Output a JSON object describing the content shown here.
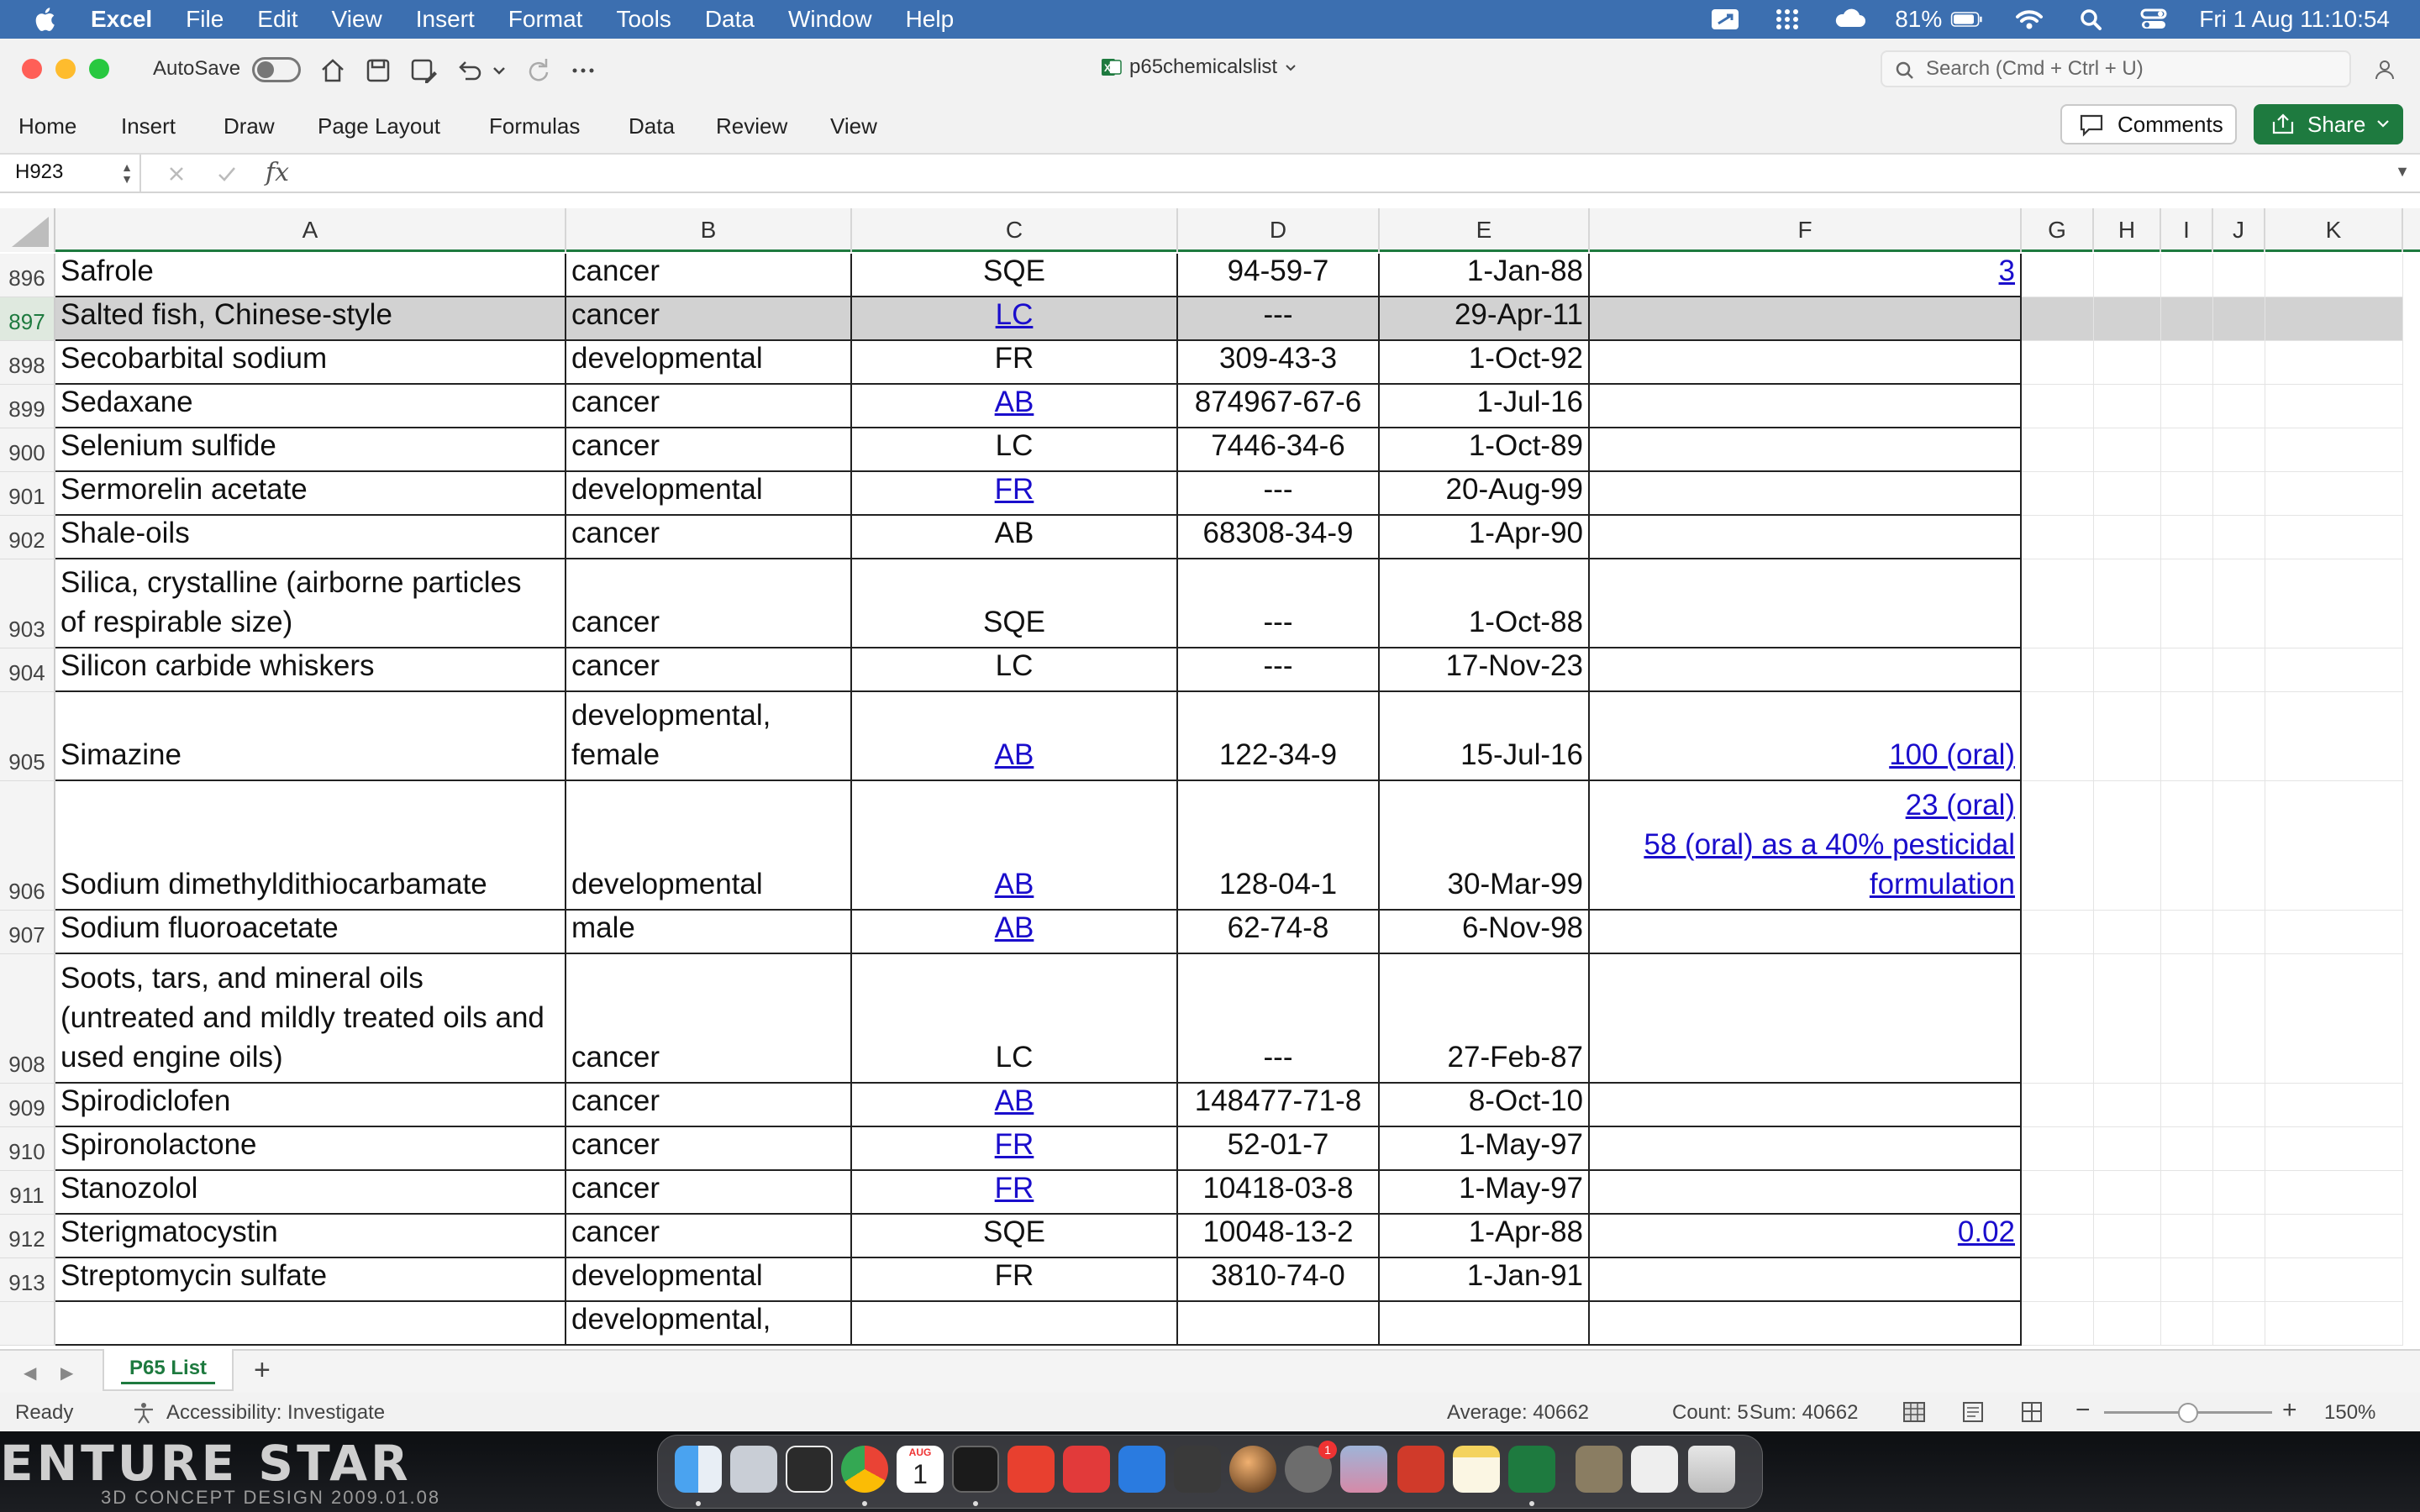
{
  "menubar": {
    "app": "Excel",
    "items": [
      "File",
      "Edit",
      "View",
      "Insert",
      "Format",
      "Tools",
      "Data",
      "Window",
      "Help"
    ],
    "battery": "81%",
    "datetime": "Fri 1 Aug  11:10:54"
  },
  "titlebar": {
    "autosave_label": "AutoSave",
    "doc_title": "p65chemicalslist",
    "search_placeholder": "Search (Cmd + Ctrl + U)"
  },
  "ribbon": {
    "tabs": [
      "Home",
      "Insert",
      "Draw",
      "Page Layout",
      "Formulas",
      "Data",
      "Review",
      "View"
    ],
    "comments": "Comments",
    "share": "Share"
  },
  "formula_bar": {
    "name_box": "H923",
    "fx": "fx",
    "value": ""
  },
  "columns": [
    "A",
    "B",
    "C",
    "D",
    "E",
    "F",
    "G",
    "H",
    "I",
    "J",
    "K"
  ],
  "rows": [
    {
      "n": "896",
      "a": [
        "Safrole"
      ],
      "b": [
        "cancer"
      ],
      "c": "SQE",
      "c_link": false,
      "d": "94-59-7",
      "e": "1-Jan-88",
      "f": [
        "3"
      ],
      "f_link": true
    },
    {
      "n": "897",
      "a": [
        "Salted fish, Chinese-style"
      ],
      "b": [
        "cancer"
      ],
      "c": "LC",
      "c_link": true,
      "d": "---",
      "e": "29-Apr-11",
      "f": [],
      "f_link": false,
      "selected": true
    },
    {
      "n": "898",
      "a": [
        "Secobarbital sodium"
      ],
      "b": [
        "developmental"
      ],
      "c": "FR",
      "c_link": false,
      "d": "309-43-3",
      "e": "1-Oct-92",
      "f": [],
      "f_link": false
    },
    {
      "n": "899",
      "a": [
        "Sedaxane"
      ],
      "b": [
        "cancer"
      ],
      "c": "AB",
      "c_link": true,
      "d": "874967-67-6",
      "e": "1-Jul-16",
      "f": [],
      "f_link": false
    },
    {
      "n": "900",
      "a": [
        "Selenium sulfide"
      ],
      "b": [
        "cancer"
      ],
      "c": "LC",
      "c_link": false,
      "d": "7446-34-6",
      "e": "1-Oct-89",
      "f": [],
      "f_link": false
    },
    {
      "n": "901",
      "a": [
        "Sermorelin acetate"
      ],
      "b": [
        "developmental"
      ],
      "c": "FR",
      "c_link": true,
      "d": "---",
      "e": "20-Aug-99",
      "f": [],
      "f_link": false
    },
    {
      "n": "902",
      "a": [
        "Shale-oils"
      ],
      "b": [
        "cancer"
      ],
      "c": "AB",
      "c_link": false,
      "d": "68308-34-9",
      "e": "1-Apr-90",
      "f": [],
      "f_link": false
    },
    {
      "n": "903",
      "a": [
        "Silica, crystalline (airborne particles",
        "of respirable size)"
      ],
      "b": [
        "cancer"
      ],
      "c": "SQE",
      "c_link": false,
      "d": "---",
      "e": "1-Oct-88",
      "f": [],
      "f_link": false
    },
    {
      "n": "904",
      "a": [
        "Silicon carbide whiskers"
      ],
      "b": [
        "cancer"
      ],
      "c": "LC",
      "c_link": false,
      "d": "---",
      "e": "17-Nov-23",
      "f": [],
      "f_link": false
    },
    {
      "n": "905",
      "a": [
        "Simazine"
      ],
      "b": [
        "developmental,",
        "female"
      ],
      "c": "AB",
      "c_link": true,
      "d": "122-34-9",
      "e": "15-Jul-16",
      "f": [
        "100 (oral)"
      ],
      "f_link": true
    },
    {
      "n": "906",
      "a": [
        "Sodium dimethyldithiocarbamate"
      ],
      "b": [
        "developmental"
      ],
      "c": "AB",
      "c_link": true,
      "d": "128-04-1",
      "e": "30-Mar-99",
      "f": [
        "23 (oral)",
        "58 (oral) as a 40% pesticidal",
        "formulation"
      ],
      "f_link": true
    },
    {
      "n": "907",
      "a": [
        "Sodium fluoroacetate"
      ],
      "b": [
        "male"
      ],
      "c": "AB",
      "c_link": true,
      "d": "62-74-8",
      "e": "6-Nov-98",
      "f": [],
      "f_link": false
    },
    {
      "n": "908",
      "a": [
        "Soots, tars, and mineral oils",
        "(untreated and mildly treated oils and",
        "used engine oils)"
      ],
      "b": [
        "cancer"
      ],
      "c": "LC",
      "c_link": false,
      "d": "---",
      "e": "27-Feb-87",
      "f": [],
      "f_link": false
    },
    {
      "n": "909",
      "a": [
        "Spirodiclofen"
      ],
      "b": [
        "cancer"
      ],
      "c": "AB",
      "c_link": true,
      "d": "148477-71-8",
      "e": "8-Oct-10",
      "f": [],
      "f_link": false
    },
    {
      "n": "910",
      "a": [
        "Spironolactone"
      ],
      "b": [
        "cancer"
      ],
      "c": "FR",
      "c_link": true,
      "d": "52-01-7",
      "e": "1-May-97",
      "f": [],
      "f_link": false
    },
    {
      "n": "911",
      "a": [
        "Stanozolol"
      ],
      "b": [
        "cancer"
      ],
      "c": "FR",
      "c_link": true,
      "d": "10418-03-8",
      "e": "1-May-97",
      "f": [],
      "f_link": false
    },
    {
      "n": "912",
      "a": [
        "Sterigmatocystin"
      ],
      "b": [
        "cancer"
      ],
      "c": "SQE",
      "c_link": false,
      "d": "10048-13-2",
      "e": "1-Apr-88",
      "f": [
        "0.02"
      ],
      "f_link": true
    },
    {
      "n": "913",
      "a": [
        "Streptomycin sulfate"
      ],
      "b": [
        "developmental"
      ],
      "c": "FR",
      "c_link": false,
      "d": "3810-74-0",
      "e": "1-Jan-91",
      "f": [],
      "f_link": false
    },
    {
      "n": "",
      "a": [
        ""
      ],
      "b": [
        "developmental,"
      ],
      "c": "",
      "c_link": false,
      "d": "",
      "e": "",
      "f": [],
      "f_link": false,
      "partial": true
    }
  ],
  "sheets": {
    "active": "P65 List",
    "add": "+"
  },
  "status": {
    "ready": "Ready",
    "accessibility": "Accessibility: Investigate",
    "average": "Average: 40662",
    "count": "Count: 5",
    "sum": "Sum: 40662",
    "zoom": "150%",
    "zoom_level": 0.5
  },
  "desktop": {
    "wallpaper_title": "ENTURE STAR",
    "wallpaper_subtitle": "3D CONCEPT DESIGN 2009.01.08",
    "dock_calendar": {
      "month": "AUG",
      "day": "1"
    },
    "dock_badge": "1"
  },
  "colors": {
    "excel_green": "#1e7a3f",
    "link_blue": "#1a0dcc",
    "selected_row": "#d2d2d2"
  }
}
